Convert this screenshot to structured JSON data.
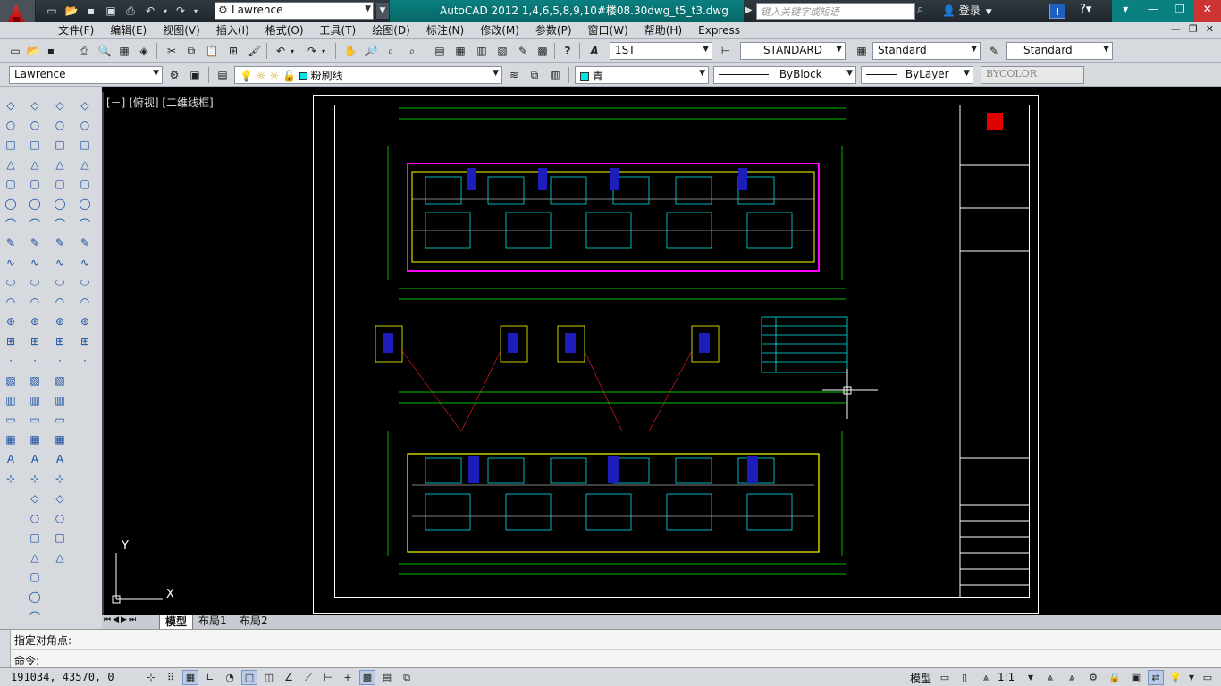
{
  "titlebar": {
    "workspace": "Lawrence",
    "title": "AutoCAD 2012    1,4,6,5,8,9,10#楼08.30dwg_t5_t3.dwg",
    "search_placeholder": "键入关键字或短语",
    "login": "登录"
  },
  "menu": [
    "文件(F)",
    "编辑(E)",
    "视图(V)",
    "插入(I)",
    "格式(O)",
    "工具(T)",
    "绘图(D)",
    "标注(N)",
    "修改(M)",
    "参数(P)",
    "窗口(W)",
    "帮助(H)",
    "Express"
  ],
  "toolbar1": {
    "text_style": "1ST",
    "dim_style": "STANDARD",
    "table_style": "Standard",
    "mleader_style": "Standard"
  },
  "toolbar2": {
    "workspace": "Lawrence",
    "layer": "粉刷线",
    "color": "青",
    "color_hex": "#00e5e5",
    "linetype": "ByBlock",
    "lineweight": "ByLayer",
    "plotstyle": "BYCOLOR"
  },
  "viewport": {
    "label": "[－] [俯视] [二维线框]",
    "ucs_x": "X",
    "ucs_y": "Y"
  },
  "layout_tabs": [
    "模型",
    "布局1",
    "布局2"
  ],
  "command": {
    "history": "指定对角点:",
    "prompt": "命令:"
  },
  "status": {
    "coords": "191034,  43570,  0",
    "model": "模型",
    "scale": "1:1"
  }
}
